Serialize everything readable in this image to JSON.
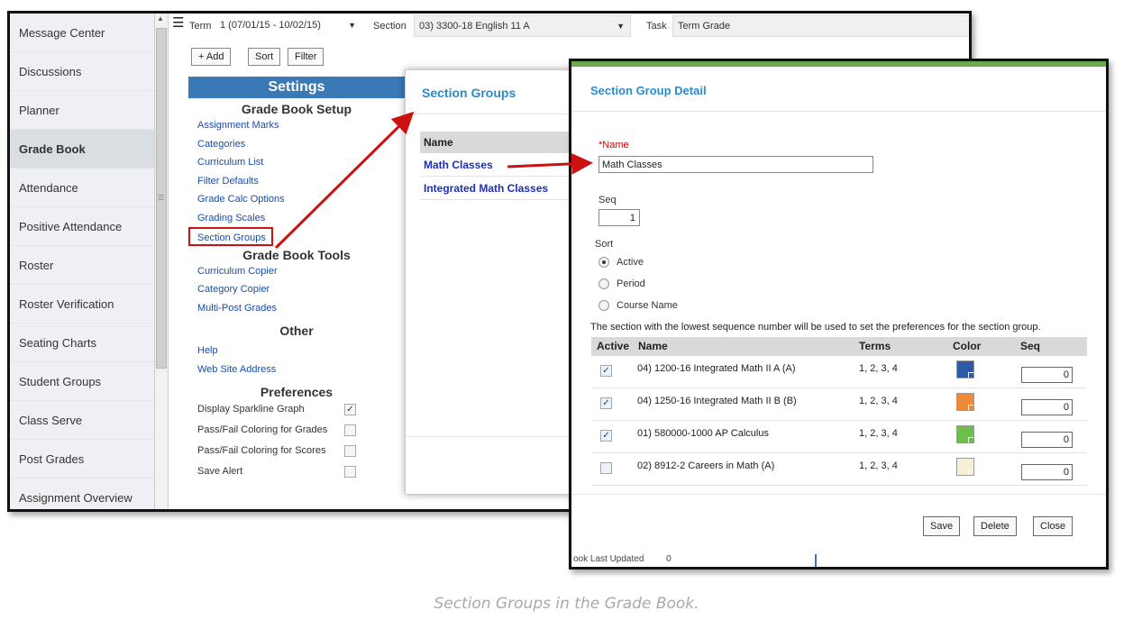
{
  "nav": {
    "items": [
      {
        "label": "Message Center"
      },
      {
        "label": "Discussions"
      },
      {
        "label": "Planner"
      },
      {
        "label": "Grade Book",
        "active": true
      },
      {
        "label": "Attendance"
      },
      {
        "label": "Positive Attendance"
      },
      {
        "label": "Roster"
      },
      {
        "label": "Roster Verification"
      },
      {
        "label": "Seating Charts"
      },
      {
        "label": "Student Groups"
      },
      {
        "label": "Class Serve"
      },
      {
        "label": "Post Grades"
      },
      {
        "label": "Assignment Overview"
      }
    ]
  },
  "topbar": {
    "term_label": "Term",
    "term_value": "1 (07/01/15 - 10/02/15)",
    "section_label": "Section",
    "section_value": "03) 3300-18 English 11 A",
    "task_label": "Task",
    "task_value": "Term Grade",
    "add_label": "+ Add",
    "sort_label": "Sort",
    "filter_label": "Filter"
  },
  "settings": {
    "title": "Settings",
    "setup_heading": "Grade Book Setup",
    "setup_links": [
      "Assignment Marks",
      "Categories",
      "Curriculum List",
      "Filter Defaults",
      "Grade Calc Options",
      "Grading Scales",
      "Section Groups"
    ],
    "tools_heading": "Grade Book Tools",
    "tools_links": [
      "Curriculum Copier",
      "Category Copier",
      "Multi-Post Grades"
    ],
    "other_heading": "Other",
    "other_links": [
      "Help",
      "Web Site Address"
    ],
    "preferences_heading": "Preferences",
    "preferences": [
      {
        "label": "Display Sparkline Graph",
        "checked": true
      },
      {
        "label": "Pass/Fail Coloring for Grades",
        "checked": false
      },
      {
        "label": "Pass/Fail Coloring for Scores",
        "checked": false
      },
      {
        "label": "Save Alert",
        "checked": false
      }
    ]
  },
  "section_groups": {
    "title": "Section Groups",
    "column_name": "Name",
    "rows": [
      "Math Classes",
      "Integrated Math Classes"
    ]
  },
  "detail": {
    "title": "Section Group Detail",
    "name_label": "*Name",
    "name_value": "Math Classes",
    "seq_label": "Seq",
    "seq_value": "1",
    "sort_label": "Sort",
    "sort_options": [
      {
        "label": "Active",
        "checked": true
      },
      {
        "label": "Period",
        "checked": false
      },
      {
        "label": "Course Name",
        "checked": false
      }
    ],
    "note": "The section with the lowest sequence number will be used to set the preferences for the section group.",
    "columns": {
      "active": "Active",
      "name": "Name",
      "terms": "Terms",
      "color": "Color",
      "seq": "Seq"
    },
    "rows": [
      {
        "active": true,
        "name": "04) 1200-16 Integrated Math II A (A)",
        "terms": "1, 2, 3, 4",
        "color": "#2e5aa8",
        "seq": "0"
      },
      {
        "active": true,
        "name": "04) 1250-16 Integrated Math II B (B)",
        "terms": "1, 2, 3, 4",
        "color": "#f08a35",
        "seq": "0"
      },
      {
        "active": true,
        "name": "01) 580000-1000 AP Calculus",
        "terms": "1, 2, 3, 4",
        "color": "#6cc04a",
        "seq": "0"
      },
      {
        "active": false,
        "name": "02) 8912-2 Careers in Math (A)",
        "terms": "1, 2, 3, 4",
        "color": "#f5f0d8",
        "seq": "0"
      }
    ],
    "save_label": "Save",
    "delete_label": "Delete",
    "close_label": "Close",
    "bleed_text": "ook Last Updated",
    "bleed_value": "0"
  },
  "colors": {
    "header_blue": "#3a79b6",
    "title_blue": "#2a8bc8",
    "highlight_red": "#cc1111",
    "accent_green": "#6aa84f"
  },
  "caption": "Section Groups in the Grade Book."
}
